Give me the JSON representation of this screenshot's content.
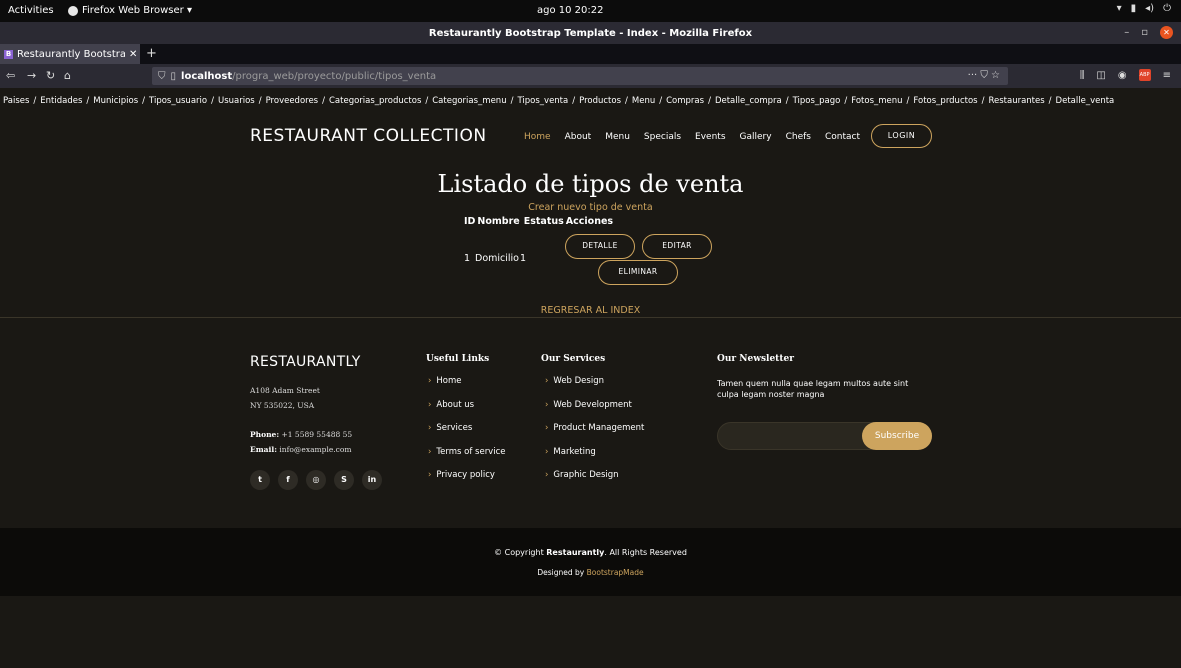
{
  "system_bar": {
    "activities": "Activities",
    "app_name": "Firefox Web Browser ▾",
    "clock": "ago 10  20:22"
  },
  "window": {
    "title": "Restaurantly Bootstrap Template - Index - Mozilla Firefox"
  },
  "tab": {
    "favicon": "B",
    "title": "Restaurantly Bootstrap"
  },
  "url": {
    "host": "localhost",
    "path": "/progra_web/proyecto/public/tipos_venta"
  },
  "breadcrumb": [
    "Paises",
    "Entidades",
    "Municipios",
    "Tipos_usuario",
    "Usuarios",
    "Proveedores",
    "Categorias_productos",
    "Categorias_menu",
    "Tipos_venta",
    "Productos",
    "Menu",
    "Compras",
    "Detalle_compra",
    "Tipos_pago",
    "Fotos_menu",
    "Fotos_prductos",
    "Restaurantes",
    "Detalle_venta"
  ],
  "header": {
    "logo": "RESTAURANT COLLECTION",
    "menu": [
      "Home",
      "About",
      "Menu",
      "Specials",
      "Events",
      "Gallery",
      "Chefs",
      "Contact"
    ],
    "login": "LOGIN"
  },
  "main": {
    "title": "Listado de tipos de venta",
    "create_link": "Crear nuevo tipo de venta",
    "headers": [
      "ID",
      "Nombre",
      "Estatus",
      "Acciones"
    ],
    "rows": [
      {
        "id": "1",
        "nombre": "Domicilio",
        "estatus": "1",
        "actions": [
          "DETALLE",
          "EDITAR",
          "ELIMINAR"
        ]
      }
    ],
    "back_link": "REGRESAR AL INDEX"
  },
  "footer": {
    "brand": "RESTAURANTLY",
    "address1": "A108 Adam Street",
    "address2": "NY 535022, USA",
    "phone_label": "Phone:",
    "phone": "+1 5589 55488 55",
    "email_label": "Email:",
    "email": "info@example.com",
    "socials": [
      "twitter-icon",
      "facebook-icon",
      "instagram-icon",
      "skype-icon",
      "linkedin-icon"
    ],
    "useful_links_title": "Useful Links",
    "useful_links": [
      "Home",
      "About us",
      "Services",
      "Terms of service",
      "Privacy policy"
    ],
    "services_title": "Our Services",
    "services": [
      "Web Design",
      "Web Development",
      "Product Management",
      "Marketing",
      "Graphic Design"
    ],
    "newsletter_title": "Our Newsletter",
    "newsletter_text": "Tamen quem nulla quae legam multos aute sint culpa legam noster magna",
    "subscribe": "Subscribe",
    "copyright_pre": "© Copyright ",
    "copyright_brand": "Restaurantly",
    "copyright_post": ". All Rights Reserved",
    "designed_pre": "Designed by ",
    "designed_by": "BootstrapMade"
  },
  "colors": {
    "accent": "#cda45e",
    "background": "#1a1814",
    "footer_bottom": "#0c0b09"
  }
}
